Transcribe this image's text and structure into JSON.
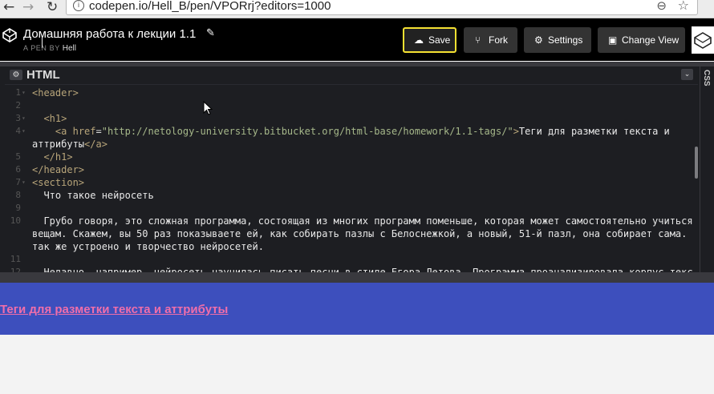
{
  "browser": {
    "back": "←",
    "forward": "→",
    "reload": "↻",
    "info_icon": "i",
    "url": "codepen.io/Hell_B/pen/VPORrj?editors=1000",
    "zoom_icon": "⊖",
    "star_icon": "☆"
  },
  "pen": {
    "title": "Домашняя работа к лекции 1.1",
    "edit_icon": "✎",
    "by_label": "A PEN BY",
    "author": "Hell"
  },
  "toolbar": {
    "save_label": "Save",
    "save_icon": "☁",
    "fork_label": "Fork",
    "fork_icon": "⑂",
    "settings_label": "Settings",
    "settings_icon": "⚙",
    "view_label": "Change View",
    "view_icon": "▣"
  },
  "editor": {
    "title": "HTML",
    "gear_icon": "⚙",
    "collapse_icon": "⌄",
    "side_tab": "CSS",
    "lines": [
      {
        "n": "1",
        "fold": "▾",
        "html": "<span class='tag'>&lt;header&gt;</span>"
      },
      {
        "n": "2",
        "fold": "",
        "html": ""
      },
      {
        "n": "3",
        "fold": "▾",
        "html": "  <span class='tag'>&lt;h1&gt;</span>"
      },
      {
        "n": "4",
        "fold": "▾",
        "html": "    <span class='tag'>&lt;a</span> <span class='attr'>href</span>=<span class='str'>\"http://netology-university.bitbucket.org/html-base/homework/1.1-tags/\"</span><span class='tag'>&gt;</span><span class='txt'>Теги для разметки текста и</span>"
      },
      {
        "n": "",
        "fold": "",
        "html": "<span class='txt'>аттрибуты</span><span class='tag'>&lt;/a&gt;</span>"
      },
      {
        "n": "5",
        "fold": "",
        "html": "  <span class='tag'>&lt;/h1&gt;</span>"
      },
      {
        "n": "6",
        "fold": "",
        "html": "<span class='tag'>&lt;/header&gt;</span>"
      },
      {
        "n": "7",
        "fold": "▾",
        "html": "<span class='tag'>&lt;section&gt;</span>"
      },
      {
        "n": "8",
        "fold": "",
        "html": "  <span class='txt'>Что такое нейросеть</span>"
      },
      {
        "n": "9",
        "fold": "",
        "html": ""
      },
      {
        "n": "10",
        "fold": "",
        "html": "  <span class='txt'>Грубо говоря, это сложная программа, состоящая из многих программ поменьше, которая может самостоятельно учиться разным</span>"
      },
      {
        "n": "",
        "fold": "",
        "html": "<span class='txt'>вещам. Скажем, вы 50 раз показываете ей, как собирать пазлы с Белоснежкой, а новый, 51-й пазл, она собирает сама. Примерно</span>"
      },
      {
        "n": "",
        "fold": "",
        "html": "<span class='txt'>так же устроено и творчество нейросетей.</span>"
      },
      {
        "n": "11",
        "fold": "",
        "html": ""
      },
      {
        "n": "12",
        "fold": "",
        "html": "  <span class='txt'>Недавно, например, нейросеть научилась писать песни в стиле Егора Летова. Программа проанализировала корпус текстов</span>"
      }
    ]
  },
  "preview": {
    "link_text": "Теги для разметки текста и аттрибуты"
  },
  "colors": {
    "preview_header_bg": "#3d4fbd",
    "preview_link": "#f06eaa",
    "save_border": "#f5e132"
  }
}
